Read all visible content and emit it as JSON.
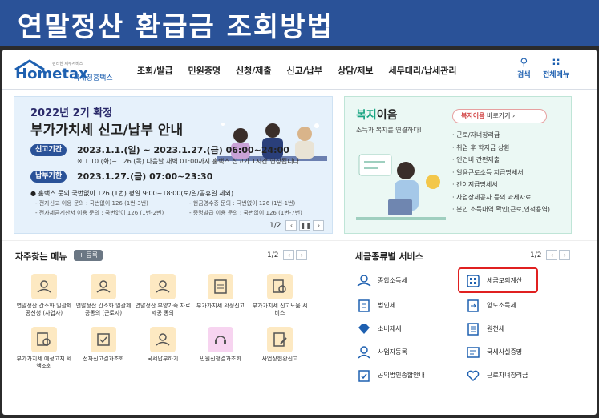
{
  "banner": {
    "title": "연말정산 환급금 조회방법"
  },
  "nav": {
    "logo_text": "Hometax",
    "logo_sub": "국세청홈택스",
    "logo_tiny": "편리한 세무서비스",
    "menu": [
      "조회/발급",
      "민원증명",
      "신청/제출",
      "신고/납부",
      "상담/제보",
      "세무대리/납세관리"
    ],
    "search_label": "검색",
    "all_menu_label": "전체메뉴"
  },
  "promo": {
    "line1": "2022년 2기 확정",
    "line2": "부가가치세 신고/납부 안내",
    "period_label": "신고기간",
    "period": "2023.1.1.(일) ~ 2023.1.27.(금) 06:00~24:00",
    "note": "※ 1.10.(화)~1.26.(목) 다음날 새벽 01:00까지 홈택스 신고가 1시간 연장됩니다.",
    "deadline_label": "납부기한",
    "deadline": "2023.1.27.(금) 07:00~23:30",
    "contact": "● 홈택스 문의 국번없이 126 (1번)  평일 9:00~18:00(토/일/공휴일 제외)",
    "sub1a": "- 전자신고 이용 문의 : 국번없이 126 (1번-3번)",
    "sub1b": "- 현금영수증 문의 : 국번없이 126 (1번-1번)",
    "sub2a": "- 전자세금계산서 이용 문의 : 국번없이 126 (1번-2번)",
    "sub2b": "- 증명발급 이용 문의 : 국번없이 126 (1번-7번)",
    "pager": "1/2"
  },
  "welfare": {
    "title_accent": "복지",
    "title_rest": "이음",
    "subtitle": "소득과 복지를 연결하다!",
    "button_accent": "복지이음",
    "button_rest": " 바로가기",
    "items": [
      "근로/자녀장려금",
      "취업 후 학자금 상환",
      "인건비 간편제출",
      "일용근로소득 지급명세서",
      "간이지급명세서",
      "사업장제공자 등의 과세자료",
      "본인 소득내역 확인(근로,인적용역)"
    ]
  },
  "favorites": {
    "title": "자주찾는 메뉴",
    "add_label": "+ 등록",
    "pager": "1/2",
    "items": [
      {
        "label": "연말정산 간소화 일괄제공신청 (사업자)",
        "icon": "person-tray-icon"
      },
      {
        "label": "연말정산 간소화 일괄제공동의 (근로자)",
        "icon": "person-tray-icon"
      },
      {
        "label": "연말정산 부양가족 자료제공 동의",
        "icon": "person-tray-icon"
      },
      {
        "label": "부가가치세 확정신고",
        "icon": "vat-document-icon"
      },
      {
        "label": "부가가치세 신고도움 서비스",
        "icon": "document-search-icon"
      },
      {
        "label": "부가가치세 예정고지 세액조회",
        "icon": "document-search-icon"
      },
      {
        "label": "전자신고결과조회",
        "icon": "document-check-icon"
      },
      {
        "label": "국세납부하기",
        "icon": "person-tray-icon"
      },
      {
        "label": "민원신청결과조회",
        "icon": "headset-icon"
      },
      {
        "label": "사업장현황신고",
        "icon": "document-pen-icon"
      }
    ]
  },
  "tax_services": {
    "title": "세금종류별 서비스",
    "pager": "1/2",
    "items": [
      {
        "label": "종합소득세",
        "icon": "coins-hand-icon"
      },
      {
        "label": "세금모의계산",
        "icon": "calculator-icon"
      },
      {
        "label": "법인세",
        "icon": "building-doc-icon"
      },
      {
        "label": "양도소득세",
        "icon": "transfer-doc-icon"
      },
      {
        "label": "소비제세",
        "icon": "diamond-icon"
      },
      {
        "label": "원천세",
        "icon": "ledger-icon"
      },
      {
        "label": "사업자등록",
        "icon": "person-badge-icon"
      },
      {
        "label": "국세사실증명",
        "icon": "certificate-icon"
      },
      {
        "label": "공익법인종합안내",
        "icon": "clipboard-check-icon"
      },
      {
        "label": "근로자녀장려금",
        "icon": "heart-hand-icon"
      }
    ]
  },
  "colors": {
    "banner": "#2a5298",
    "accent_blue": "#1e60b0",
    "welfare_green": "#1aa583",
    "highlight_red": "#e02020"
  }
}
